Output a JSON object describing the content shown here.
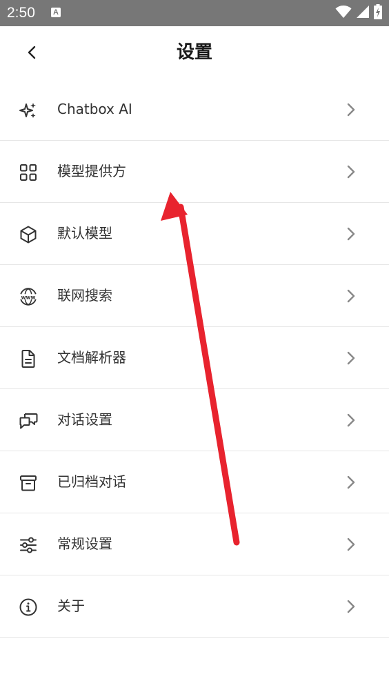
{
  "status_bar": {
    "time": "2:50",
    "notification_badge": "A",
    "icons": [
      "wifi-icon",
      "signal-icon",
      "battery-charging-icon"
    ]
  },
  "header": {
    "title": "设置",
    "back_icon": "chevron-left-icon"
  },
  "menu": {
    "items": [
      {
        "label": "Chatbox AI",
        "icon": "sparkles-icon"
      },
      {
        "label": "模型提供方",
        "icon": "grid-icon"
      },
      {
        "label": "默认模型",
        "icon": "cube-icon"
      },
      {
        "label": "联网搜索",
        "icon": "globe-www-icon"
      },
      {
        "label": "文档解析器",
        "icon": "document-icon"
      },
      {
        "label": "对话设置",
        "icon": "chat-bubbles-icon"
      },
      {
        "label": "已归档对话",
        "icon": "archive-icon"
      },
      {
        "label": "常规设置",
        "icon": "sliders-icon"
      },
      {
        "label": "关于",
        "icon": "info-icon"
      }
    ]
  },
  "colors": {
    "status_bar_bg": "#777777",
    "annotation_arrow": "#e8232e",
    "icon_color": "#333333",
    "chevron_color": "#888888",
    "divider": "#e6e6e6"
  }
}
